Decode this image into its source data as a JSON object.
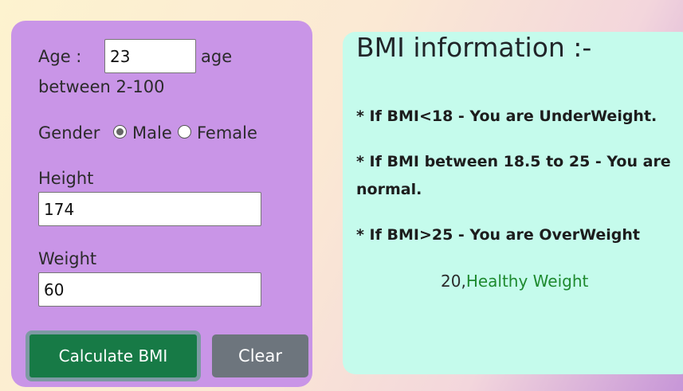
{
  "form": {
    "age_label": "Age :",
    "age_value": "23",
    "age_hint_a": "age",
    "age_hint_b": "between 2-100",
    "gender_label": "Gender",
    "gender_options": [
      {
        "label": "Male",
        "checked": true
      },
      {
        "label": "Female",
        "checked": false
      }
    ],
    "height_label": "Height",
    "height_value": "174",
    "weight_label": "Weight",
    "weight_value": "60",
    "calculate_label": "Calculate BMI",
    "clear_label": "Clear"
  },
  "info": {
    "title": "BMI information :-",
    "rules": [
      "* If BMI<18 - You are UnderWeight.",
      "* If BMI between 18.5 to 25 - You are normal.",
      "* If BMI>25 - You are OverWeight"
    ],
    "result_value": "20,",
    "result_category": "Healthy Weight"
  },
  "colors": {
    "form_card": "#c995e7",
    "info_card": "#c5fbec",
    "calculate_button": "#177a46",
    "clear_button": "#6d757d",
    "result_category": "#1e8a2f"
  }
}
